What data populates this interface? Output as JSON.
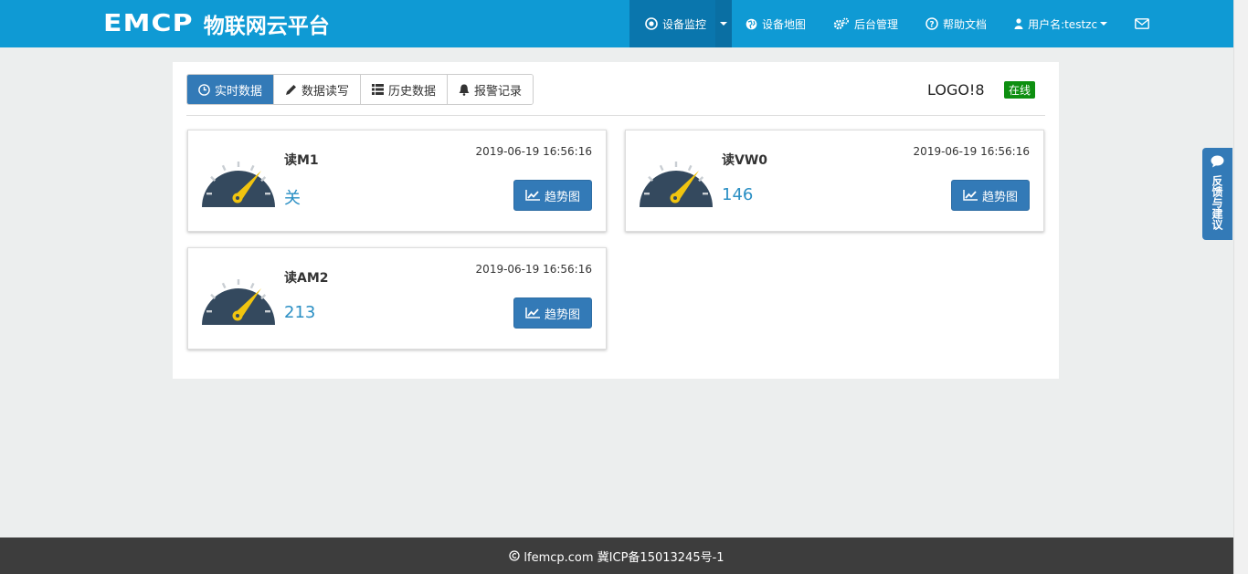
{
  "header": {
    "brand_mark": "EMCP",
    "brand_text": "物联网云平台",
    "nav": {
      "device_monitor": "设备监控",
      "device_map": "设备地图",
      "admin": "后台管理",
      "help": "帮助文档",
      "user": "用户名:testzc"
    }
  },
  "tabs": {
    "realtime": "实时数据",
    "readwrite": "数据读写",
    "history": "历史数据",
    "alarm": "报警记录"
  },
  "device": {
    "name": "LOGO!8",
    "status": "在线"
  },
  "cards": [
    {
      "title": "读M1",
      "time": "2019-06-19 16:56:16",
      "value": "关",
      "button": "趋势图"
    },
    {
      "title": "读VW0",
      "time": "2019-06-19 16:56:16",
      "value": "146",
      "button": "趋势图"
    },
    {
      "title": "读AM2",
      "time": "2019-06-19 16:56:16",
      "value": "213",
      "button": "趋势图"
    }
  ],
  "feedback": "反馈与建议",
  "footer": "lfemcp.com 冀ICP备15013245号-1",
  "colors": {
    "topbar": "#0f9ad4",
    "active_nav": "#0a76ad",
    "primary": "#337ab7",
    "online": "#0d8f10",
    "value": "#2a8fc4",
    "footer": "#3d3d3d"
  }
}
